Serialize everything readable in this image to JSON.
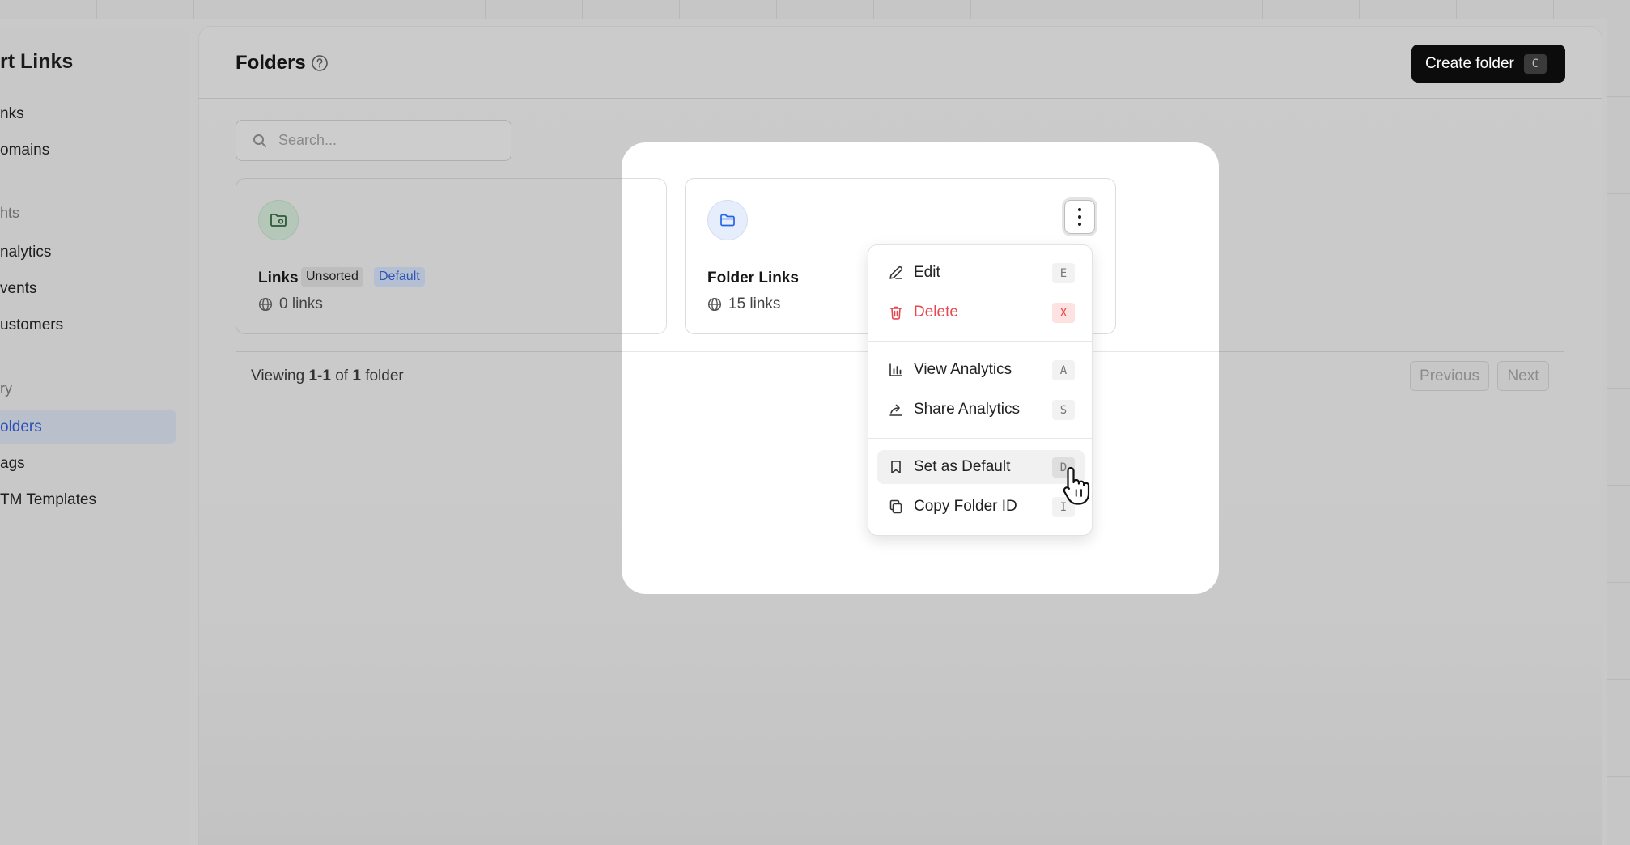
{
  "sidebar": {
    "brand": "rt Links",
    "items": [
      {
        "label": "nks"
      },
      {
        "label": "omains"
      },
      {
        "label": "hts",
        "section": true
      },
      {
        "label": "nalytics"
      },
      {
        "label": "vents"
      },
      {
        "label": "ustomers"
      },
      {
        "label": "ry",
        "section": true
      },
      {
        "label": "olders",
        "active": true
      },
      {
        "label": "ags"
      },
      {
        "label": "TM Templates"
      }
    ]
  },
  "header": {
    "title": "Folders",
    "create_label": "Create folder",
    "create_shortcut": "C"
  },
  "search": {
    "placeholder": "Search..."
  },
  "folders": [
    {
      "name": "Links",
      "badge_unsorted": "Unsorted",
      "badge_default": "Default",
      "count": "0 links"
    },
    {
      "name": "Folder Links",
      "count": "15 links"
    }
  ],
  "pagination": {
    "viewing_prefix": "Viewing ",
    "range": "1-1",
    "of": " of ",
    "total": "1",
    "suffix": " folder",
    "previous": "Previous",
    "next": "Next"
  },
  "menu": {
    "edit": {
      "label": "Edit",
      "key": "E"
    },
    "delete": {
      "label": "Delete",
      "key": "X"
    },
    "view_analytics": {
      "label": "View Analytics",
      "key": "A"
    },
    "share_analytics": {
      "label": "Share Analytics",
      "key": "S"
    },
    "set_default": {
      "label": "Set as Default",
      "key": "D"
    },
    "copy_id": {
      "label": "Copy Folder ID",
      "key": "I"
    }
  },
  "colors": {
    "accent_blue": "#2563eb",
    "danger": "#e5484d",
    "primary_button": "#0c0c0c"
  }
}
